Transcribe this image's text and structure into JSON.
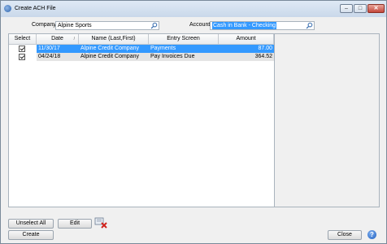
{
  "window": {
    "title": "Create ACH File",
    "min": "–",
    "max": "□",
    "close": "✕"
  },
  "filters": {
    "company_label": "Company",
    "company_value": "Alpine Sports",
    "account_label": "Account",
    "account_value": "Cash in Bank - Checking"
  },
  "grid": {
    "columns": [
      "Select",
      "Date",
      "Name (Last,First)",
      "Entry Screen",
      "Amount"
    ],
    "rows": [
      {
        "checked": true,
        "date": "11/30/17",
        "name": "Alpine Credit Company",
        "entry": "Payments",
        "amount": "87.00"
      },
      {
        "checked": true,
        "date": "04/24/18",
        "name": "Alpine Credit Company",
        "entry": "Pay Invoices Due",
        "amount": "364.52"
      }
    ]
  },
  "buttons": {
    "unselect_all": "Unselect All",
    "edit": "Edit",
    "create": "Create",
    "close": "Close",
    "help": "?"
  }
}
